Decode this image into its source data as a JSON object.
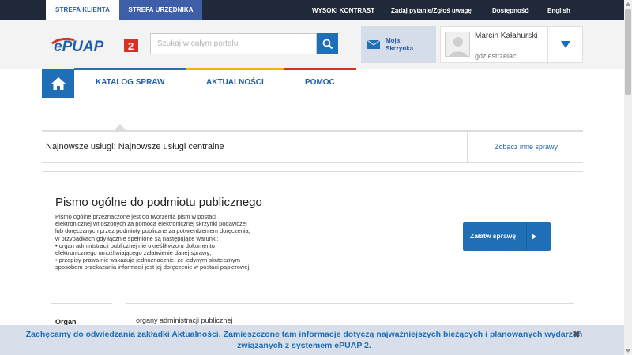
{
  "topbar": {
    "tabs": [
      "STREFA KLIENTA",
      "STREFA URZĘDNIKA"
    ],
    "links": [
      "WYSOKI KONTRAST",
      "Zadaj pytanie/Zgłoś uwagę",
      "Dostępność",
      "English"
    ]
  },
  "header": {
    "logo_text": "ePUAP",
    "logo_badge": "2",
    "search_placeholder": "Szukaj w całym portalu",
    "mailbox_label": "Moja Skrzynka",
    "user_name": "Marcin Kałahurski",
    "user_place": "gdziestrzelac"
  },
  "nav": {
    "items": [
      "KATALOG SPRAW",
      "AKTUALNOŚCI",
      "POMOC"
    ],
    "colors": [
      "#2e6db4",
      "#f4b400",
      "#d93025",
      "#7bb33a"
    ]
  },
  "panel": {
    "newest": "Najnowsze usługi: Najnowsze usługi centralne",
    "see_other": "Zobacz inne sprawy"
  },
  "service": {
    "title": "Pismo ogólne do podmiotu publicznego",
    "desc": [
      "Pismo ogólne przeznaczone jest do tworzenia pism w postaci",
      "elektronicznej wnoszonych za pomocą elektronicznej skrzynki podawczej",
      "lub doręczanych przez podmioty publiczne za potwierdzeniem doręczenia,",
      "w przypadkach gdy łącznie spełnione są następujące warunki:",
      "• organ administracji publicznej nie określił wzoru dokumentu",
      "elektronicznego umożliwiającego załatwienie danej sprawy;",
      "• przepisy prawa nie wskazują jednoznacznie, że jedynym skutecznym",
      "sposobem przekazania informacji jest jej doręczenie w postaci papierowej."
    ],
    "action": "Załatw sprawę",
    "organ_label": "Organ",
    "organ_value": "organy administracji publicznej"
  },
  "banner": {
    "text": "Zachęcamy do odwiedzania zakładki Aktualności. Zamieszczone tam informacje dotyczą najważniejszych bieżących i planowanych wydarzeń związanych z systemem ePUAP 2.",
    "close": "✖"
  }
}
